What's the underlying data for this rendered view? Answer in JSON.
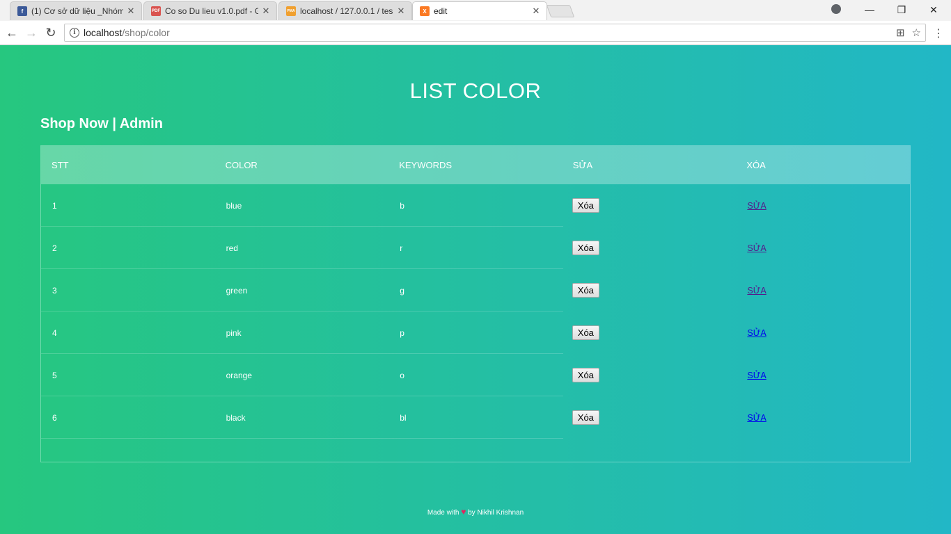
{
  "browser": {
    "tabs": [
      {
        "title": "(1) Cơ sở dữ liệu _Nhóm",
        "icon": "facebook-icon",
        "color": "#3b5998",
        "glyph": "f"
      },
      {
        "title": "Co so Du lieu v1.0.pdf - G",
        "icon": "pdf-icon",
        "color": "#d9534f",
        "glyph": "PDF"
      },
      {
        "title": "localhost / 127.0.0.1 / tes",
        "icon": "phpmyadmin-icon",
        "color": "#f0a030",
        "glyph": "PMA"
      },
      {
        "title": "edit",
        "icon": "xampp-icon",
        "color": "#fb7a24",
        "glyph": "X"
      }
    ],
    "url_host": "localhost",
    "url_path": "/shop/color"
  },
  "page": {
    "title": "LIST COLOR",
    "brand": "Shop Now | Admin",
    "columns": [
      "STT",
      "COLOR",
      "KEYWORDS",
      "SỬA",
      "XÓA"
    ],
    "rows": [
      {
        "stt": "1",
        "color": "blue",
        "keywords": "b",
        "button": "Xóa",
        "link": "SỬA"
      },
      {
        "stt": "2",
        "color": "red",
        "keywords": "r",
        "button": "Xóa",
        "link": "SỬA"
      },
      {
        "stt": "3",
        "color": "green",
        "keywords": "g",
        "button": "Xóa",
        "link": "SỬA"
      },
      {
        "stt": "4",
        "color": "pink",
        "keywords": "p",
        "button": "Xóa",
        "link": "SỬA"
      },
      {
        "stt": "5",
        "color": "orange",
        "keywords": "o",
        "button": "Xóa",
        "link": "SỬA"
      },
      {
        "stt": "6",
        "color": "black",
        "keywords": "bl",
        "button": "Xóa",
        "link": "SỬA"
      }
    ],
    "footer_made": "Made with",
    "footer_by": "by Nikhil Krishnan",
    "gradient_start": "#26c77f",
    "gradient_end": "#22b7c6"
  }
}
